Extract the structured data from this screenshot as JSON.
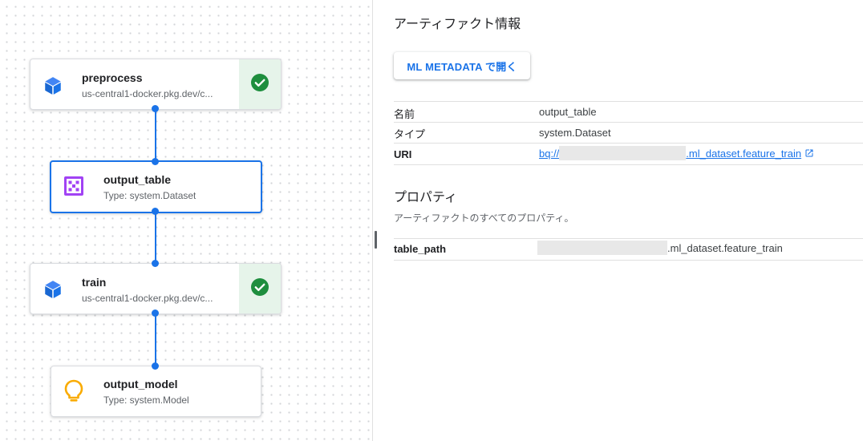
{
  "graph": {
    "nodes": [
      {
        "title": "preprocess",
        "subtitle": "us-central1-docker.pkg.dev/c...",
        "icon": "cube-icon",
        "status": "succeeded"
      },
      {
        "title": "output_table",
        "subtitle": "Type: system.Dataset",
        "icon": "dataset-icon",
        "selected": true
      },
      {
        "title": "train",
        "subtitle": "us-central1-docker.pkg.dev/c...",
        "icon": "cube-icon",
        "status": "succeeded"
      },
      {
        "title": "output_model",
        "subtitle": "Type: system.Model",
        "icon": "lightbulb-icon"
      }
    ]
  },
  "panel": {
    "title": "アーティファクト情報",
    "open_button": "ML METADATA で開く",
    "info": [
      {
        "label": "名前",
        "value": "output_table"
      },
      {
        "label": "タイプ",
        "value": "system.Dataset"
      },
      {
        "label": "URI",
        "value_prefix": "bq://",
        "value_suffix": ".ml_dataset.feature_train"
      }
    ],
    "properties_title": "プロパティ",
    "properties_desc": "アーティファクトのすべてのプロパティ。",
    "properties": [
      {
        "label": "table_path",
        "value_suffix": ".ml_dataset.feature_train"
      }
    ]
  },
  "colors": {
    "accent": "#1a73e8",
    "success": "#1e8e3e",
    "success_bg": "#e6f4ea",
    "dataset_purple": "#a142f4",
    "model_yellow": "#f9ab00"
  }
}
